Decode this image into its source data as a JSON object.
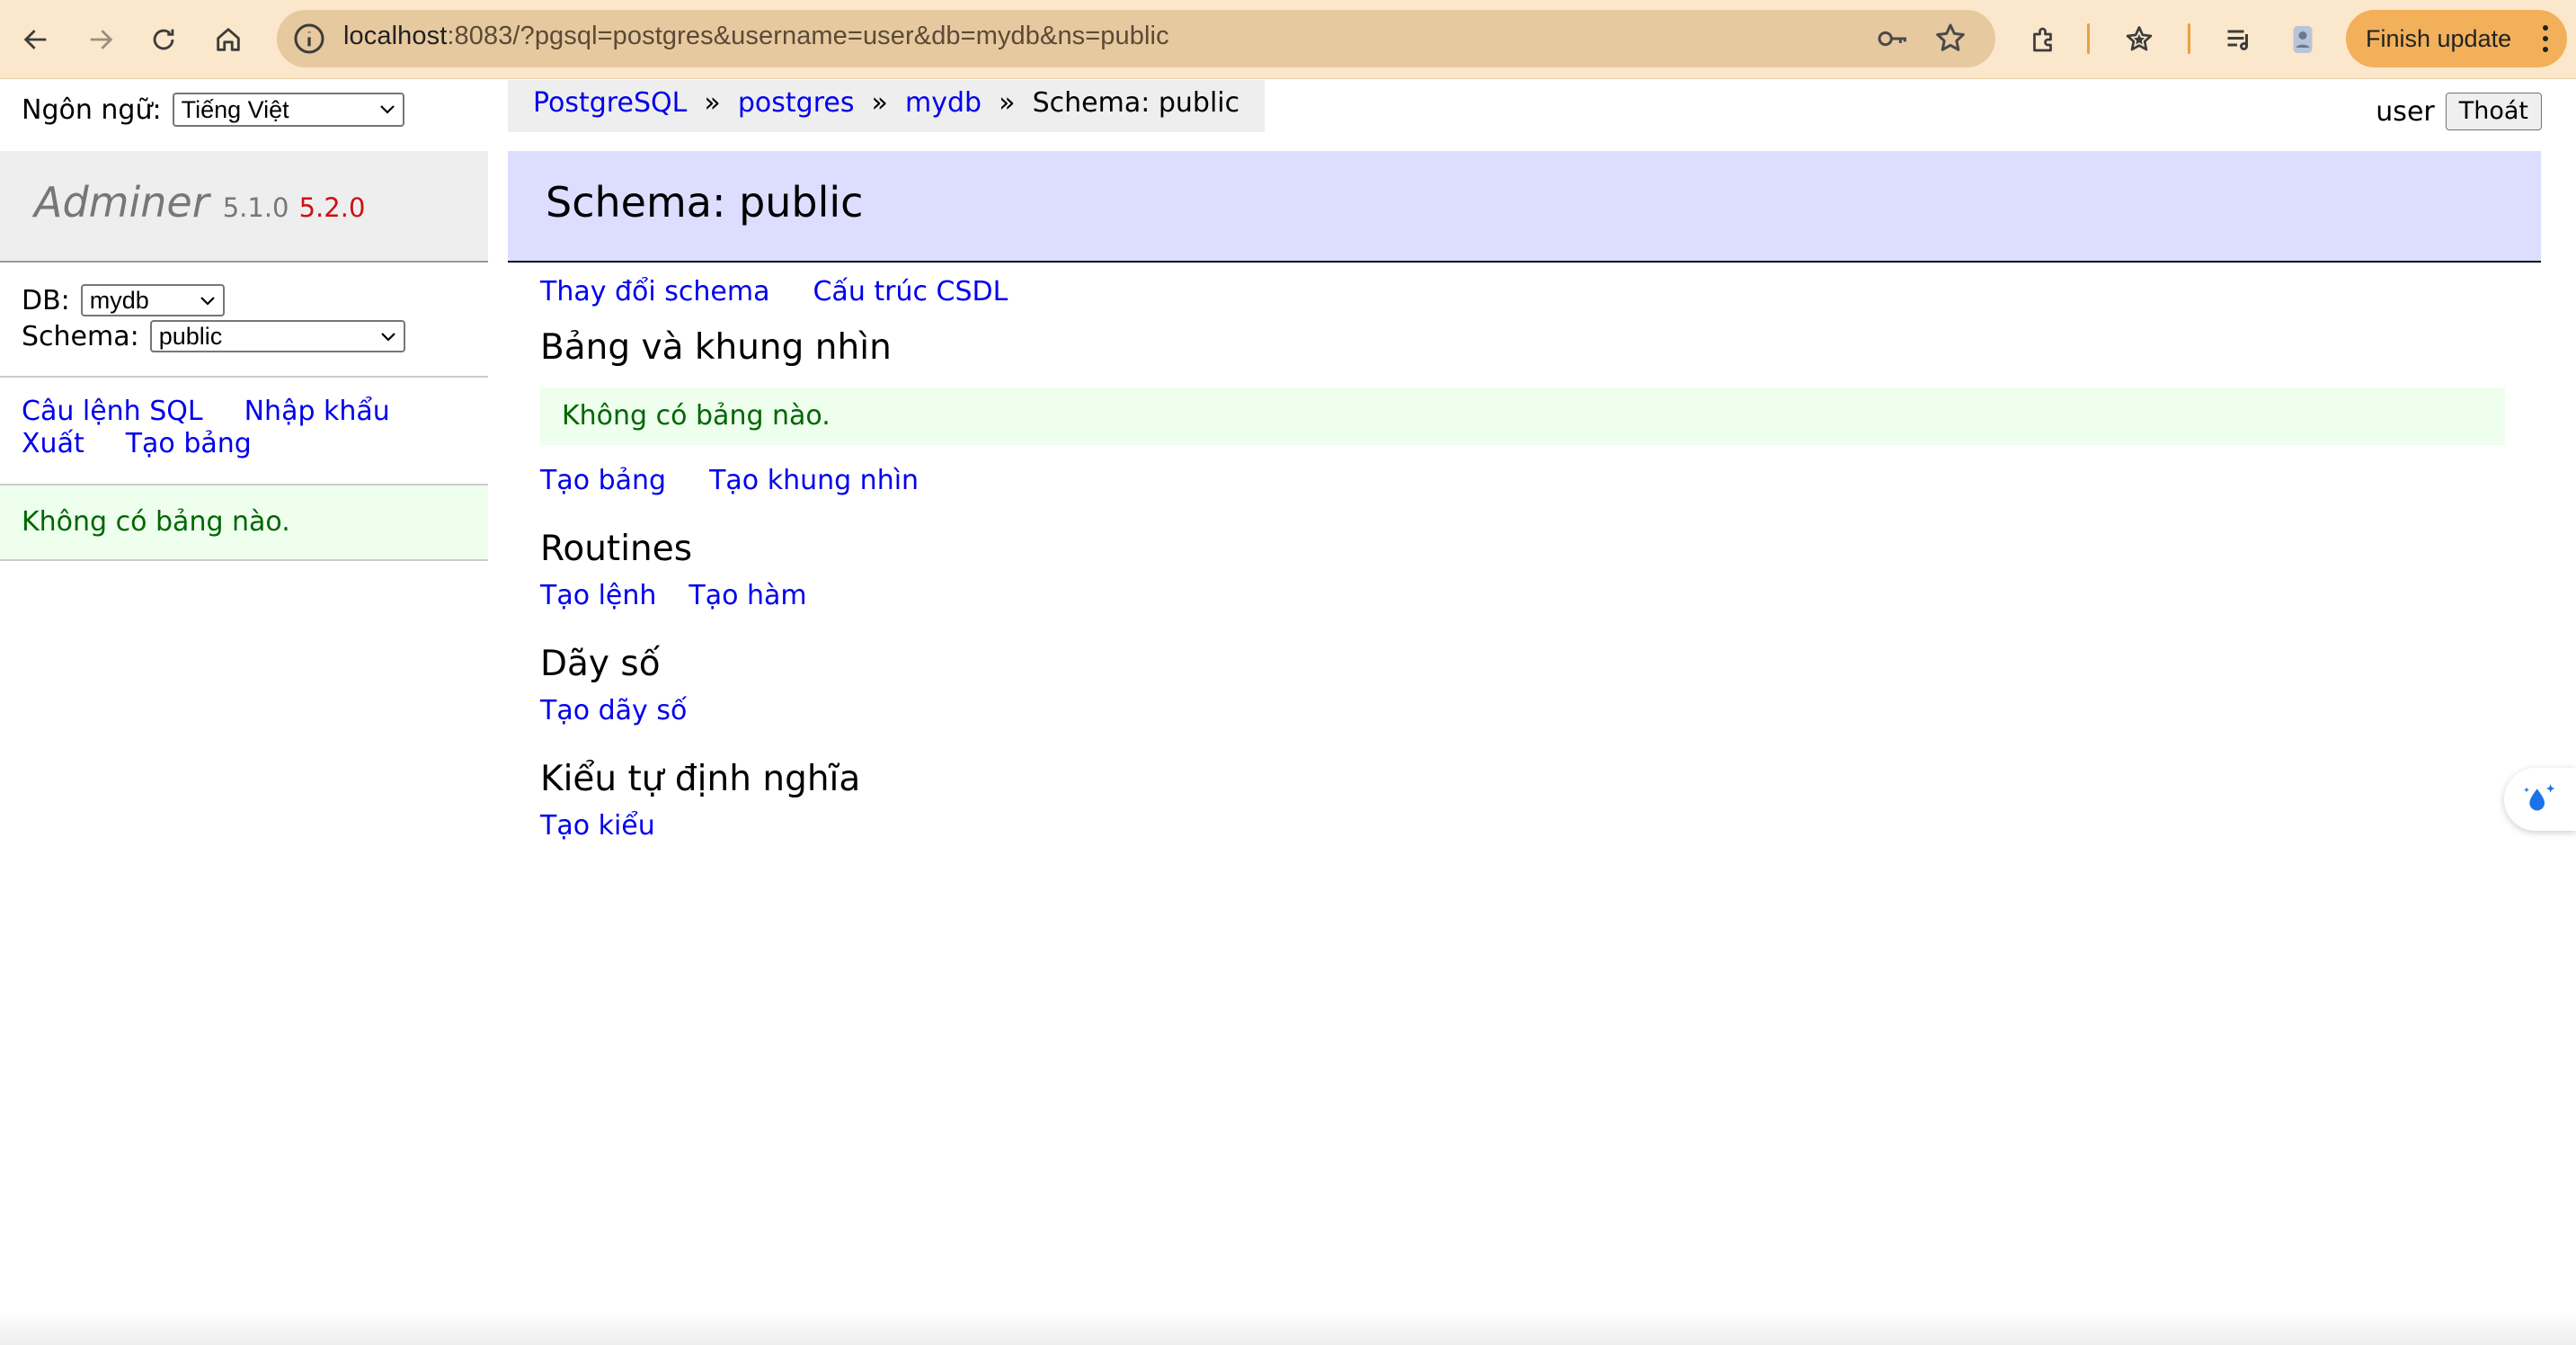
{
  "browser": {
    "url_host": "localhost",
    "url_path": ":8083/?pgsql=postgres&username=user&db=mydb&ns=public",
    "finish_update_label": "Finish update",
    "colors": {
      "toolbar_bg": "#fbe7cb",
      "omnibox_bg": "#e7c9a0",
      "update_button": "#f2b05a"
    },
    "icons": [
      "back-icon",
      "forward-icon",
      "reload-icon",
      "home-icon",
      "site-info-icon",
      "password-key-icon",
      "bookmark-star-icon",
      "extensions-icon",
      "bookmarks-star-icon",
      "reading-list-icon",
      "profile-icon",
      "more-vert-icon"
    ]
  },
  "lang": {
    "label": "Ngôn ngữ:",
    "selected": "Tiếng Việt"
  },
  "breadcrumb": {
    "items": [
      "PostgreSQL",
      "postgres",
      "mydb"
    ],
    "separator": "»",
    "current": "Schema: public"
  },
  "user": {
    "name": "user",
    "logout_label": "Thoát"
  },
  "sidebar": {
    "logo_name": "Adminer",
    "version": "5.1.0",
    "new_version": "5.2.0",
    "db_label": "DB:",
    "db_selected": "mydb",
    "schema_label": "Schema:",
    "schema_selected": "public",
    "links": [
      "Câu lệnh SQL",
      "Nhập khẩu",
      "Xuất",
      "Tạo bảng"
    ],
    "no_tables": "Không có bảng nào."
  },
  "content": {
    "title": "Schema: public",
    "top_links": [
      "Thay đổi schema",
      "Cấu trúc CSDL"
    ],
    "tables_heading": "Bảng và khung nhìn",
    "no_tables": "Không có bảng nào.",
    "table_links": [
      "Tạo bảng",
      "Tạo khung nhìn"
    ],
    "routines_heading": "Routines",
    "routine_links": [
      "Tạo lệnh",
      "Tạo hàm"
    ],
    "sequences_heading": "Dãy số",
    "sequence_links": [
      "Tạo dãy số"
    ],
    "types_heading": "Kiểu tự định nghĩa",
    "type_links": [
      "Tạo kiểu"
    ]
  },
  "colors": {
    "link": "#0000ee",
    "message_bg": "#eeffee",
    "message_text": "#006600",
    "header_bg": "#ddddff",
    "version_new": "#cc1111"
  }
}
